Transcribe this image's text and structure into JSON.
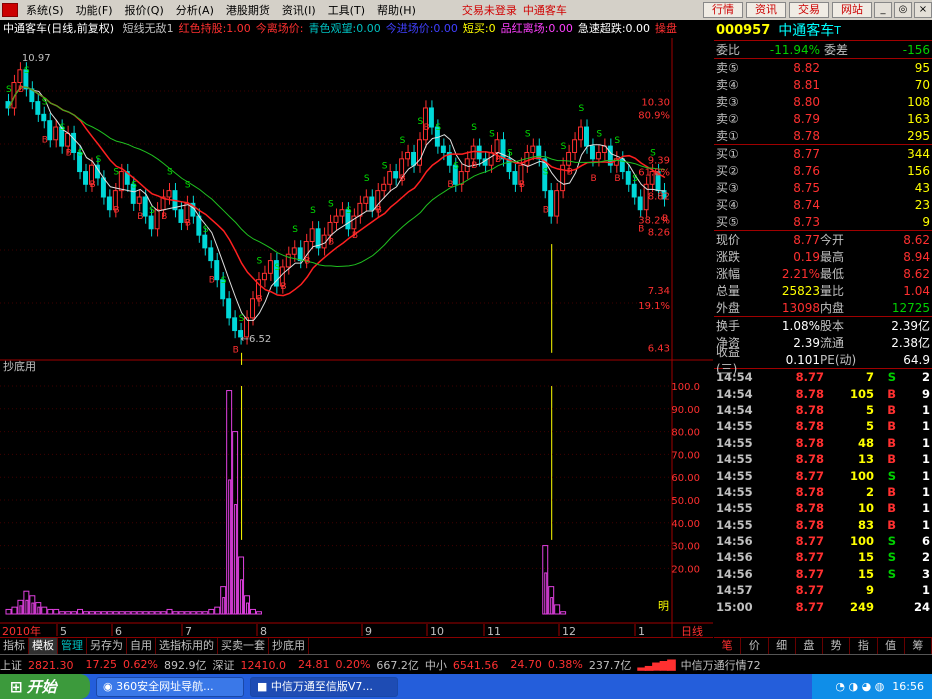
{
  "menu": {
    "items": [
      "系统(S)",
      "功能(F)",
      "报价(Q)",
      "分析(A)",
      "港股期货",
      "资讯(I)",
      "工具(T)",
      "帮助(H)"
    ],
    "login_status": "交易未登录",
    "title": "中通客车",
    "buttons": [
      "行情",
      "资讯",
      "交易",
      "网站"
    ]
  },
  "chart": {
    "title": "中通客车(日线,前复权)",
    "indicators": [
      {
        "label": "短线无敌1",
        "color": "#c0c0c0"
      },
      {
        "label": "红色持股:1.00",
        "color": "#ff3030"
      },
      {
        "label": "今离场价:",
        "color": "#ff3030"
      },
      {
        "label": "青色观望:0.00",
        "color": "#00c0c0"
      },
      {
        "label": "今进场价:0.00",
        "color": "#4040ff"
      },
      {
        "label": "短买:0",
        "color": "#ffff00"
      },
      {
        "label": "品红离场:0.00",
        "color": "#ff40ff"
      },
      {
        "label": "急速超跌:0.00",
        "color": "#ffffff"
      },
      {
        "label": "操盘",
        "color": "#ff3030"
      }
    ],
    "high_label": "10.97",
    "low_label": "6.52",
    "price_ticks": [
      "10.30",
      "9.39",
      "8.82",
      "8.26",
      "7.34",
      "6.43"
    ],
    "pct_ticks": [
      "80.9%",
      "61.8%",
      "38.2%",
      "19.1%"
    ],
    "sub_title": "抄底用",
    "sub_ticks": [
      "100.0",
      "90.00",
      "80.00",
      "70.00",
      "60.00",
      "50.00",
      "40.00",
      "30.00",
      "20.00"
    ],
    "sub_mark": "明",
    "x_labels": [
      "2010年",
      "5",
      "6",
      "7",
      "8",
      "9",
      "10",
      "11",
      "12",
      "1",
      "日线"
    ]
  },
  "chart_data": {
    "type": "candlestick",
    "ylim": [
      6.3,
      11.3
    ],
    "candles_note": "daily OHLC",
    "close": [
      10.2,
      10.6,
      10.8,
      10.5,
      10.3,
      10.1,
      10.0,
      9.7,
      9.9,
      9.6,
      9.8,
      9.5,
      9.2,
      9.0,
      9.3,
      9.1,
      8.8,
      8.6,
      8.9,
      9.2,
      9.0,
      8.7,
      8.8,
      8.5,
      8.3,
      8.6,
      8.8,
      8.9,
      8.6,
      8.4,
      8.7,
      8.5,
      8.2,
      8.0,
      7.8,
      7.5,
      7.2,
      6.9,
      6.7,
      6.6,
      6.9,
      7.2,
      7.5,
      7.6,
      7.8,
      7.4,
      7.7,
      7.9,
      8.0,
      7.8,
      8.1,
      8.3,
      8.0,
      8.2,
      8.4,
      8.5,
      8.6,
      8.3,
      8.5,
      8.7,
      8.8,
      8.6,
      8.9,
      9.0,
      9.2,
      9.1,
      9.4,
      9.5,
      9.3,
      9.7,
      10.2,
      9.9,
      9.6,
      9.5,
      9.3,
      9.0,
      9.2,
      9.4,
      9.6,
      9.4,
      9.3,
      9.5,
      9.7,
      9.4,
      9.2,
      9.0,
      9.3,
      9.5,
      9.6,
      9.4,
      8.9,
      8.5,
      8.9,
      9.3,
      9.5,
      9.7,
      9.9,
      9.6,
      9.4,
      9.5,
      9.6,
      9.3,
      9.4,
      9.2,
      9.0,
      8.8,
      8.6,
      9.0,
      9.2,
      8.9,
      8.77
    ],
    "indicator_values": [
      2,
      3,
      6,
      10,
      8,
      5,
      3,
      2,
      2,
      1,
      1,
      1,
      2,
      1,
      1,
      1,
      1,
      1,
      1,
      1,
      1,
      1,
      1,
      1,
      1,
      1,
      1,
      2,
      1,
      1,
      1,
      1,
      1,
      1,
      2,
      3,
      12,
      98,
      80,
      25,
      8,
      2,
      1,
      0,
      0,
      0,
      0,
      0,
      0,
      0,
      0,
      0,
      0,
      0,
      0,
      0,
      0,
      0,
      0,
      0,
      0,
      0,
      0,
      0,
      0,
      0,
      0,
      0,
      0,
      0,
      0,
      0,
      0,
      0,
      0,
      0,
      0,
      0,
      0,
      0,
      0,
      0,
      0,
      0,
      0,
      0,
      0,
      0,
      0,
      0,
      30,
      12,
      4,
      1,
      0,
      0,
      0,
      0,
      0,
      0,
      0,
      0,
      0,
      0,
      0,
      0,
      0,
      0,
      0,
      0,
      0
    ]
  },
  "quote": {
    "code": "000957",
    "name": "中通客车",
    "suffix": "T",
    "wb_label": "委比",
    "wb_value": "-11.94%",
    "wc_label": "委差",
    "wc_value": "-156",
    "asks": [
      {
        "label": "卖⑤",
        "price": "8.82",
        "vol": "95"
      },
      {
        "label": "卖④",
        "price": "8.81",
        "vol": "70"
      },
      {
        "label": "卖③",
        "price": "8.80",
        "vol": "108"
      },
      {
        "label": "卖②",
        "price": "8.79",
        "vol": "163"
      },
      {
        "label": "卖①",
        "price": "8.78",
        "vol": "295"
      }
    ],
    "bids": [
      {
        "label": "买①",
        "price": "8.77",
        "vol": "344"
      },
      {
        "label": "买②",
        "price": "8.76",
        "vol": "156"
      },
      {
        "label": "买③",
        "price": "8.75",
        "vol": "43"
      },
      {
        "label": "买④",
        "price": "8.74",
        "vol": "23"
      },
      {
        "label": "买⑤",
        "price": "8.73",
        "vol": "9"
      }
    ],
    "stats": [
      {
        "l1": "现价",
        "v1": "8.77",
        "c1": "red",
        "l2": "今开",
        "v2": "8.62",
        "c2": "red"
      },
      {
        "l1": "涨跌",
        "v1": "0.19",
        "c1": "red",
        "l2": "最高",
        "v2": "8.94",
        "c2": "red"
      },
      {
        "l1": "涨幅",
        "v1": "2.21%",
        "c1": "red",
        "l2": "最低",
        "v2": "8.62",
        "c2": "red"
      },
      {
        "l1": "总量",
        "v1": "25823",
        "c1": "yellow",
        "l2": "量比",
        "v2": "1.04",
        "c2": "red"
      },
      {
        "l1": "外盘",
        "v1": "13098",
        "c1": "red",
        "l2": "内盘",
        "v2": "12725",
        "c2": "green"
      }
    ],
    "fund": [
      {
        "l1": "换手",
        "v1": "1.08%",
        "l2": "股本",
        "v2": "2.39亿"
      },
      {
        "l1": "净资",
        "v1": "2.39",
        "l2": "流通",
        "v2": "2.38亿"
      },
      {
        "l1": "收益(三)",
        "v1": "0.101",
        "l2": "PE(动)",
        "v2": "64.9"
      }
    ],
    "ticks": [
      {
        "t": "14:54",
        "p": "8.77",
        "q": "7",
        "s": "S",
        "n": "2"
      },
      {
        "t": "14:54",
        "p": "8.78",
        "q": "105",
        "s": "B",
        "n": "9"
      },
      {
        "t": "14:54",
        "p": "8.78",
        "q": "5",
        "s": "B",
        "n": "1"
      },
      {
        "t": "14:55",
        "p": "8.78",
        "q": "5",
        "s": "B",
        "n": "1"
      },
      {
        "t": "14:55",
        "p": "8.78",
        "q": "48",
        "s": "B",
        "n": "1"
      },
      {
        "t": "14:55",
        "p": "8.78",
        "q": "13",
        "s": "B",
        "n": "1"
      },
      {
        "t": "14:55",
        "p": "8.77",
        "q": "100",
        "s": "S",
        "n": "1"
      },
      {
        "t": "14:55",
        "p": "8.78",
        "q": "2",
        "s": "B",
        "n": "1"
      },
      {
        "t": "14:55",
        "p": "8.78",
        "q": "10",
        "s": "B",
        "n": "1"
      },
      {
        "t": "14:55",
        "p": "8.78",
        "q": "83",
        "s": "B",
        "n": "1"
      },
      {
        "t": "14:56",
        "p": "8.77",
        "q": "100",
        "s": "S",
        "n": "6"
      },
      {
        "t": "14:56",
        "p": "8.77",
        "q": "15",
        "s": "S",
        "n": "2"
      },
      {
        "t": "14:56",
        "p": "8.77",
        "q": "15",
        "s": "S",
        "n": "3"
      },
      {
        "t": "14:57",
        "p": "8.77",
        "q": "9",
        "s": "",
        "n": "1"
      },
      {
        "t": "15:00",
        "p": "8.77",
        "q": "249",
        "s": "",
        "n": "24"
      }
    ],
    "tabs": [
      "笔",
      "价",
      "细",
      "盘",
      "势",
      "指",
      "值",
      "筹"
    ]
  },
  "bottom_tabs": [
    "指标",
    "模板",
    "管理",
    "另存为",
    "自用",
    "选指标用的",
    "买卖一套",
    "抄底用"
  ],
  "status": {
    "sh_label": "上证",
    "sh_val": "2821.30",
    "sh_chg": "17.25",
    "sh_pct": "0.62%",
    "sh_amt": "892.9亿",
    "sz_label": "深证",
    "sz_val": "12410.0",
    "sz_chg": "24.81",
    "sz_pct": "0.20%",
    "sz_amt": "667.2亿",
    "zx_label": "中小",
    "zx_val": "6541.56",
    "zx_chg": "24.70",
    "zx_pct": "0.38%",
    "zx_amt": "237.7亿",
    "feed": "中信万通行情72"
  },
  "taskbar": {
    "start": "开始",
    "tasks": [
      "360安全网址导航...",
      "中信万通至信版V7..."
    ],
    "time": "16:56"
  }
}
